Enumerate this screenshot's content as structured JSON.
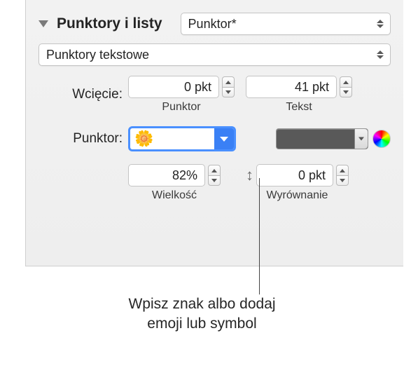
{
  "header": {
    "title": "Punktory i listy",
    "style_select": "Punktor*"
  },
  "type_select": "Punktory tekstowe",
  "indent": {
    "label": "Wcięcie:",
    "bullet_value": "0 pkt",
    "bullet_sublabel": "Punktor",
    "text_value": "41 pkt",
    "text_sublabel": "Tekst"
  },
  "bullet": {
    "label": "Punktor:",
    "emoji": "🌼"
  },
  "size": {
    "value": "82%",
    "sublabel": "Wielkość"
  },
  "align": {
    "value": "0 pkt",
    "sublabel": "Wyrównanie"
  },
  "callout": {
    "line1": "Wpisz znak albo dodaj",
    "line2": "emoji lub symbol"
  }
}
